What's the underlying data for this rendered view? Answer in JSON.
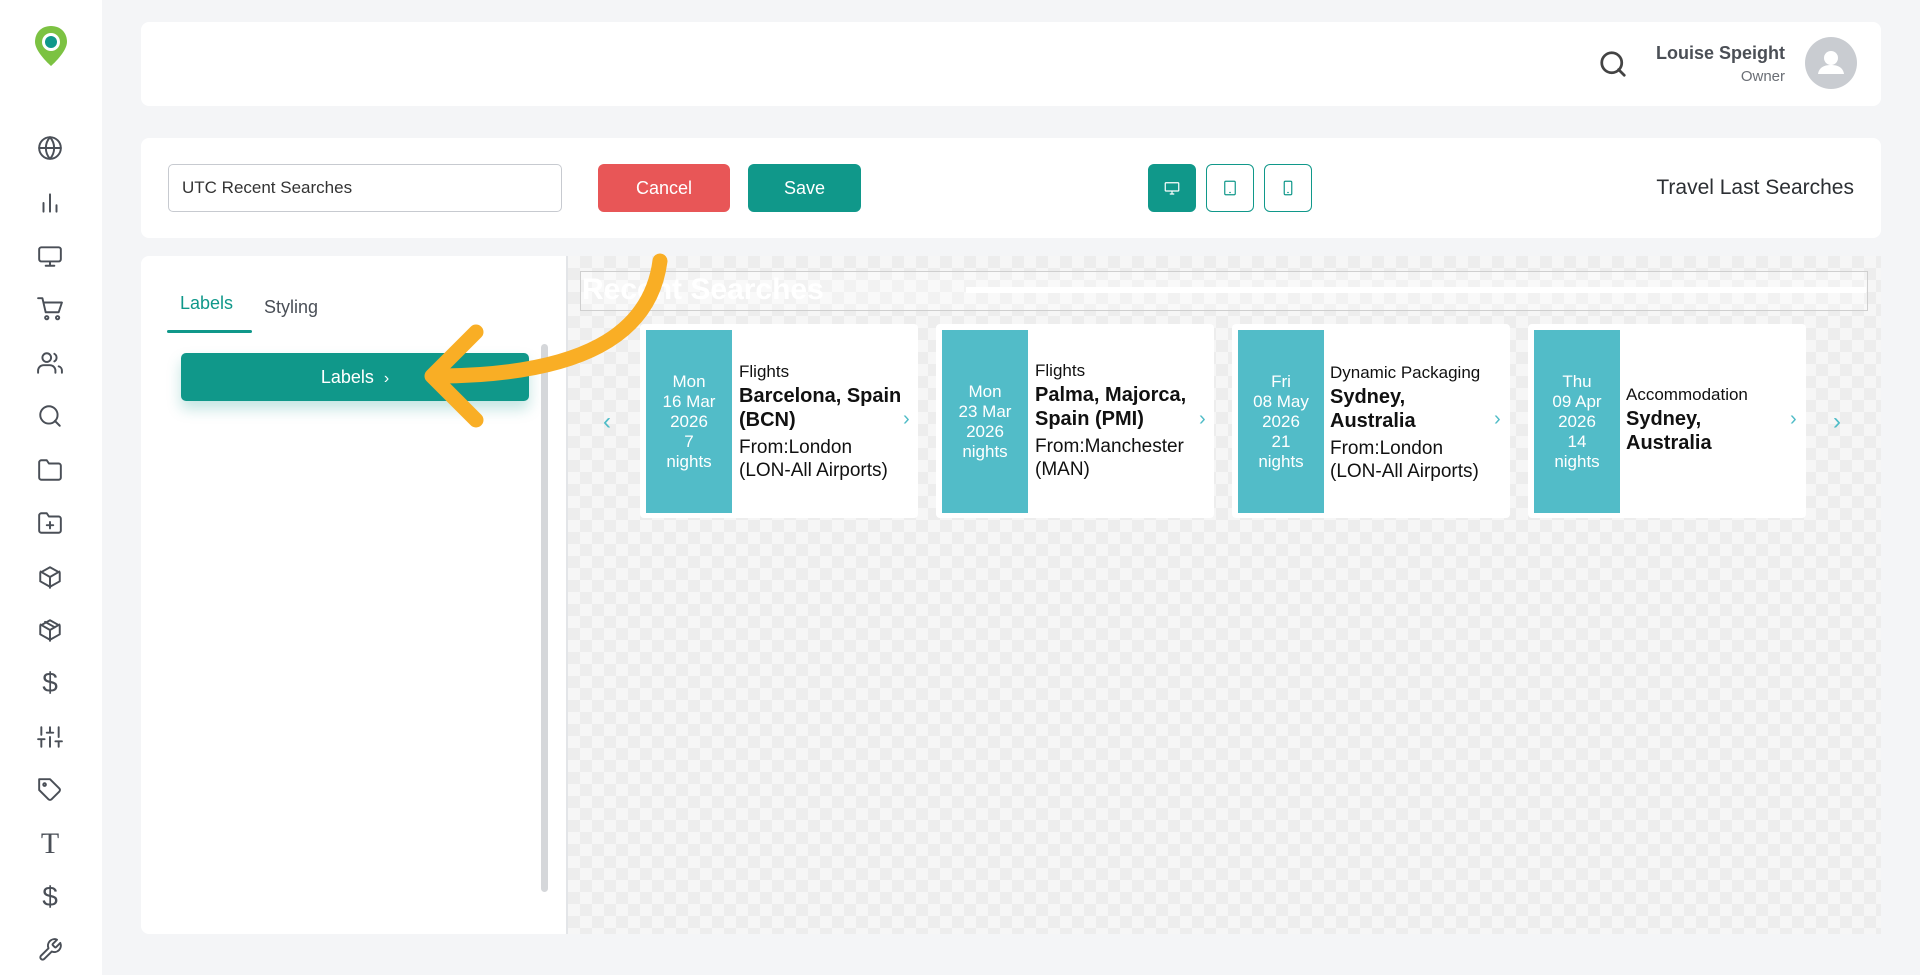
{
  "sidebar": {
    "icons": [
      "globe-icon",
      "bar-chart-icon",
      "monitor-icon",
      "cart-icon",
      "users-icon",
      "search-icon",
      "folder-icon",
      "folder-plus-icon",
      "box-icon",
      "package-icon",
      "dollar-icon",
      "sliders-icon",
      "tag-icon",
      "text-icon",
      "dollar-icon",
      "wrench-icon"
    ],
    "dollar_glyph": "$",
    "text_glyph": "T"
  },
  "header": {
    "user_name": "Louise Speight",
    "user_role": "Owner"
  },
  "toolbar": {
    "name_value": "UTC Recent Searches",
    "cancel_label": "Cancel",
    "save_label": "Save",
    "title": "Travel Last Searches",
    "devices": [
      "desktop",
      "tablet",
      "mobile"
    ],
    "active_device": "desktop"
  },
  "settings": {
    "tabs": [
      {
        "label": "Labels",
        "active": true
      },
      {
        "label": "Styling",
        "active": false
      }
    ],
    "labels_button": "Labels",
    "chevron": "›"
  },
  "preview": {
    "heading": "Recent Searches",
    "prev_arrow": "‹",
    "next_arrow": "›",
    "cards": [
      {
        "day": "Mon",
        "date": "16 Mar",
        "year": "2026",
        "nights": "7",
        "nights_label": "nights",
        "type": "Flights",
        "destination": "Barcelona, Spain (BCN)",
        "from": "From:London (LON-All Airports)"
      },
      {
        "day": "Mon",
        "date": "23 Mar",
        "year": "2026",
        "nights": "",
        "nights_label": "nights",
        "type": "Flights",
        "destination": "Palma, Majorca, Spain (PMI)",
        "from": "From:Manchester (MAN)"
      },
      {
        "day": "Fri",
        "date": "08 May",
        "year": "2026",
        "nights": "21",
        "nights_label": "nights",
        "type": "Dynamic Packaging",
        "destination": "Sydney, Australia",
        "from": "From:London (LON-All Airports)"
      },
      {
        "day": "Thu",
        "date": "09 Apr",
        "year": "2026",
        "nights": "14",
        "nights_label": "nights",
        "type": "Accommodation",
        "destination": "Sydney, Australia",
        "from": ""
      }
    ]
  },
  "colors": {
    "accent": "#10988a",
    "danger": "#e85657",
    "card_date": "#52bcc8",
    "annotation": "#f9ae25"
  }
}
